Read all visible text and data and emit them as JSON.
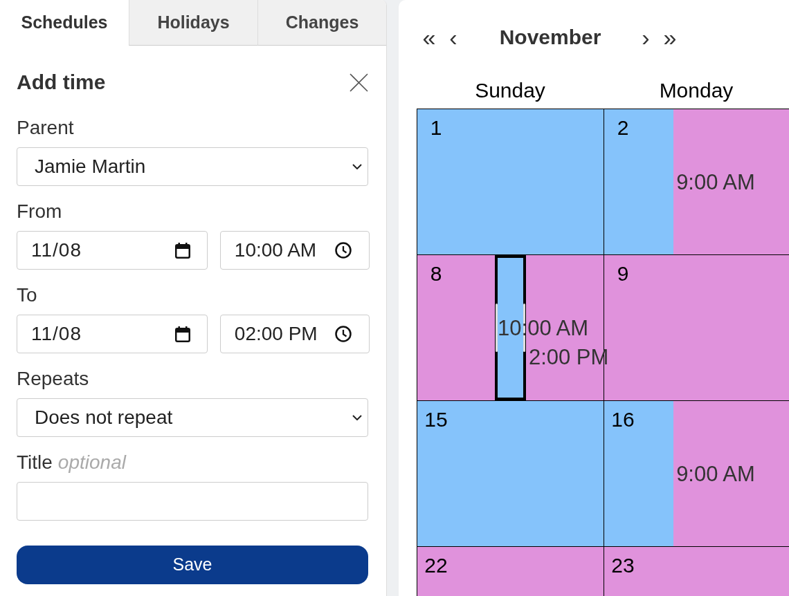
{
  "tabs": [
    {
      "label": "Schedules",
      "selected": true
    },
    {
      "label": "Holidays",
      "selected": false
    },
    {
      "label": "Changes",
      "selected": false
    }
  ],
  "form": {
    "title": "Add time",
    "fields": [
      {
        "kind": "select",
        "label": "Parent",
        "value": "Jamie Martin"
      },
      {
        "kind": "datetime",
        "label": "From",
        "date": "11/08",
        "time": "10:00 AM"
      },
      {
        "kind": "datetime",
        "label": "To",
        "date": "11/08",
        "time": "02:00 PM"
      },
      {
        "kind": "select",
        "label": "Repeats",
        "value": "Does not repeat"
      },
      {
        "kind": "text",
        "label": "Title",
        "hint": "optional"
      }
    ],
    "save": "Save"
  },
  "calendar": {
    "nav": {
      "first": "«",
      "previous": "‹",
      "next": "›",
      "last": "»"
    },
    "month": "November",
    "weekdays": [
      "Sunday",
      "Monday"
    ],
    "weeks": [
      {
        "days": [
          {
            "day": "1",
            "segments": [
              {
                "color": "#85c3fb",
                "level": 1,
                "selected": false
              }
            ]
          },
          {
            "day": "2",
            "segments": [
              {
                "color": "#85c3fb",
                "level": 0.375,
                "selected": false
              },
              {
                "color": "#e092dc",
                "level": 0.625,
                "label": "9:00 AM",
                "selected": false
              }
            ]
          }
        ]
      },
      {
        "days": [
          {
            "day": "8",
            "segments": [
              {
                "color": "#e092dc",
                "level": 0.4167,
                "selected": false
              },
              {
                "color": "#85c3fb",
                "label": "10:00 AM",
                "selected": true
              },
              {
                "color": "#e092dc",
                "level": 0.4167,
                "label": "2:00 PM",
                "selected": false
              }
            ]
          },
          {
            "day": "9",
            "segments": [
              {
                "color": "#e092dc",
                "level": 1,
                "selected": false
              }
            ]
          }
        ]
      },
      {
        "days": [
          {
            "day": "15",
            "segments": [
              {
                "color": "#85c3fb",
                "level": 1,
                "selected": false
              }
            ]
          },
          {
            "day": "16",
            "segments": [
              {
                "color": "#85c3fb",
                "level": 0.375,
                "selected": false
              },
              {
                "color": "#e092dc",
                "level": 0.625,
                "label": "9:00 AM",
                "selected": false
              }
            ]
          }
        ]
      },
      {
        "days": [
          {
            "day": "22",
            "segments": [
              {
                "color": "#e092dc",
                "level": 1,
                "selected": false
              }
            ]
          },
          {
            "day": "23",
            "segments": [
              {
                "color": "#e092dc",
                "level": 1,
                "selected": false
              }
            ]
          }
        ]
      }
    ]
  }
}
